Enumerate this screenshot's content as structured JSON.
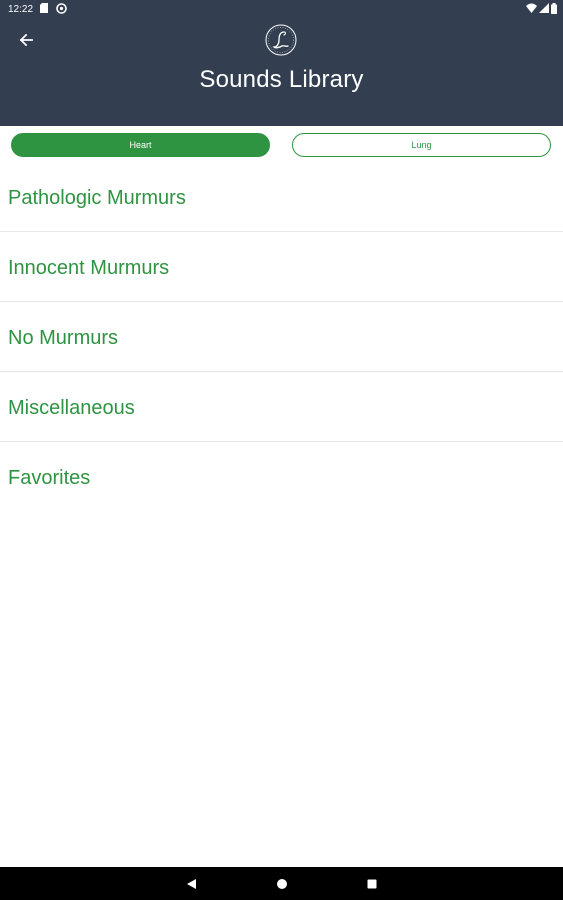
{
  "status_bar": {
    "time": "12:22"
  },
  "header": {
    "title": "Sounds Library",
    "back_icon": "arrow-left-icon",
    "logo_icon": "littmann-logo-icon",
    "background": "#333f51"
  },
  "toggle": {
    "options": [
      {
        "label": "Heart",
        "selected": true
      },
      {
        "label": "Lung",
        "selected": false
      }
    ],
    "accent": "#2e9442"
  },
  "list": {
    "items": [
      {
        "label": "Pathologic Murmurs"
      },
      {
        "label": "Innocent Murmurs"
      },
      {
        "label": "No Murmurs"
      },
      {
        "label": "Miscellaneous"
      },
      {
        "label": "Favorites"
      }
    ]
  },
  "nav_bar": {
    "icons": [
      "back-triangle-icon",
      "home-circle-icon",
      "recents-square-icon"
    ]
  }
}
